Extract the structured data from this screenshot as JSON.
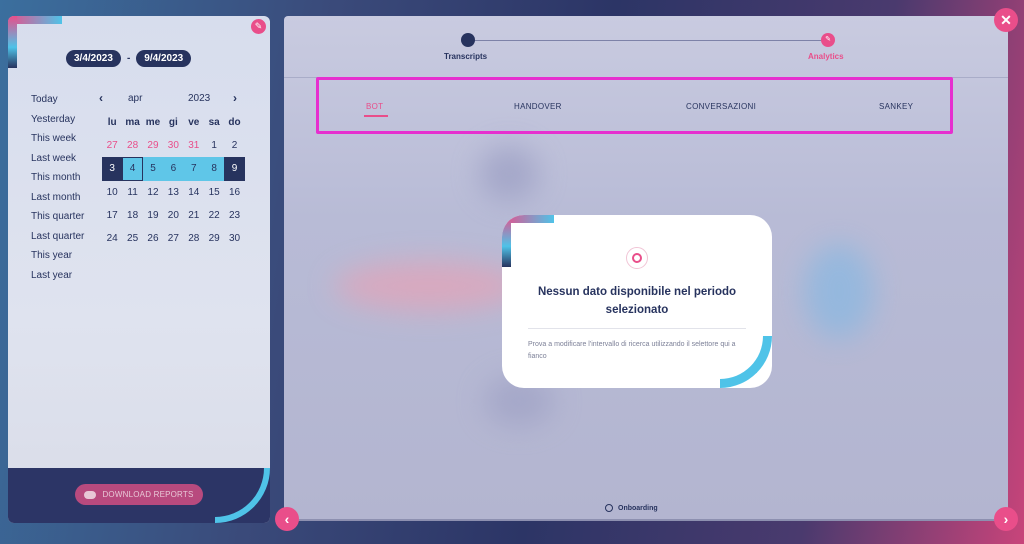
{
  "date_range": {
    "start": "3/4/2023",
    "separator": "-",
    "end": "9/4/2023"
  },
  "presets": [
    "Today",
    "Yesterday",
    "This week",
    "Last week",
    "This month",
    "Last month",
    "This quarter",
    "Last quarter",
    "This year",
    "Last year"
  ],
  "calendar": {
    "prev_icon": "‹",
    "next_icon": "›",
    "month": "apr",
    "year": "2023",
    "weekdays": [
      "lu",
      "ma",
      "me",
      "gi",
      "ve",
      "sa",
      "do"
    ],
    "weeks": [
      [
        "27",
        "28",
        "29",
        "30",
        "31",
        "1",
        "2"
      ],
      [
        "3",
        "4",
        "5",
        "6",
        "7",
        "8",
        "9"
      ],
      [
        "10",
        "11",
        "12",
        "13",
        "14",
        "15",
        "16"
      ],
      [
        "17",
        "18",
        "19",
        "20",
        "21",
        "22",
        "23"
      ],
      [
        "24",
        "25",
        "26",
        "27",
        "28",
        "29",
        "30"
      ]
    ]
  },
  "download": {
    "label": "DOWNLOAD REPORTS",
    "icon": "cloud-download-icon"
  },
  "stepper": {
    "steps": [
      {
        "label": "Transcripts",
        "icon": "list-icon"
      },
      {
        "label": "Analytics",
        "icon": "pencil-icon"
      }
    ]
  },
  "tabs": [
    "BOT",
    "HANDOVER",
    "CONVERSAZIONI",
    "SANKEY"
  ],
  "empty_state": {
    "title": "Nessun dato disponibile nel periodo selezionato",
    "description": "Prova a modificare l'intervallo di ricerca utilizzando il selettore qui a fianco",
    "icon": "ring-icon"
  },
  "footer": {
    "onboarding": "Onboarding"
  },
  "icons": {
    "close": "✕",
    "prev": "‹",
    "next": "›",
    "edit": "✎"
  },
  "colors": {
    "accent": "#e94e8a",
    "navy": "#27335e",
    "cyan": "#5fc6e8",
    "highlight": "#e62fcf"
  }
}
